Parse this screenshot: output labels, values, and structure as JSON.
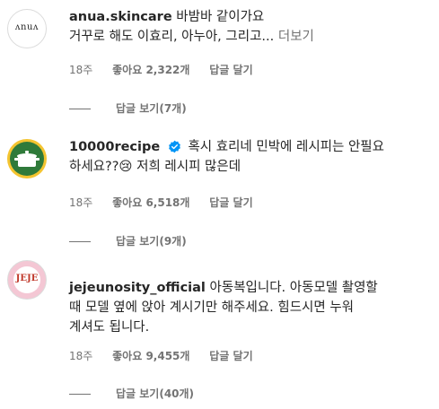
{
  "comments": [
    {
      "avatar_text": "ʌnuʌ",
      "username": "anua.skincare",
      "verified": false,
      "text_line1": "바밤바 같이가요",
      "text_line2": "거꾸로 해도 이효리, 아누아, 그리고...",
      "more_label": "더보기",
      "time": "18주",
      "likes": "좋아요 2,322개",
      "reply_label": "답글 달기",
      "view_replies": "답글 보기(7개)"
    },
    {
      "username": "10000recipe",
      "verified": true,
      "text_line1": "혹시 효리네 민박에 레시피는 안필요",
      "text_line2": "하세요??😢 저희 레시피 많은데",
      "time": "18주",
      "likes": "좋아요 6,518개",
      "reply_label": "답글 달기",
      "view_replies": "답글 보기(9개)"
    },
    {
      "avatar_text": "JEJE",
      "username": "jejeunosity_official",
      "verified": false,
      "text_line1": "아동복입니다. 아동모델 촬영할",
      "text_line2": "때 모델 옆에 앉아 계시기만 해주세요. 힘드시면 누워",
      "text_line3": "계셔도 됩니다.",
      "time": "18주",
      "likes": "좋아요 9,455개",
      "reply_label": "답글 달기",
      "view_replies": "답글 보기(40개)"
    }
  ],
  "colors": {
    "text": "#262626",
    "secondary": "#737373",
    "verified": "#0095f6"
  }
}
